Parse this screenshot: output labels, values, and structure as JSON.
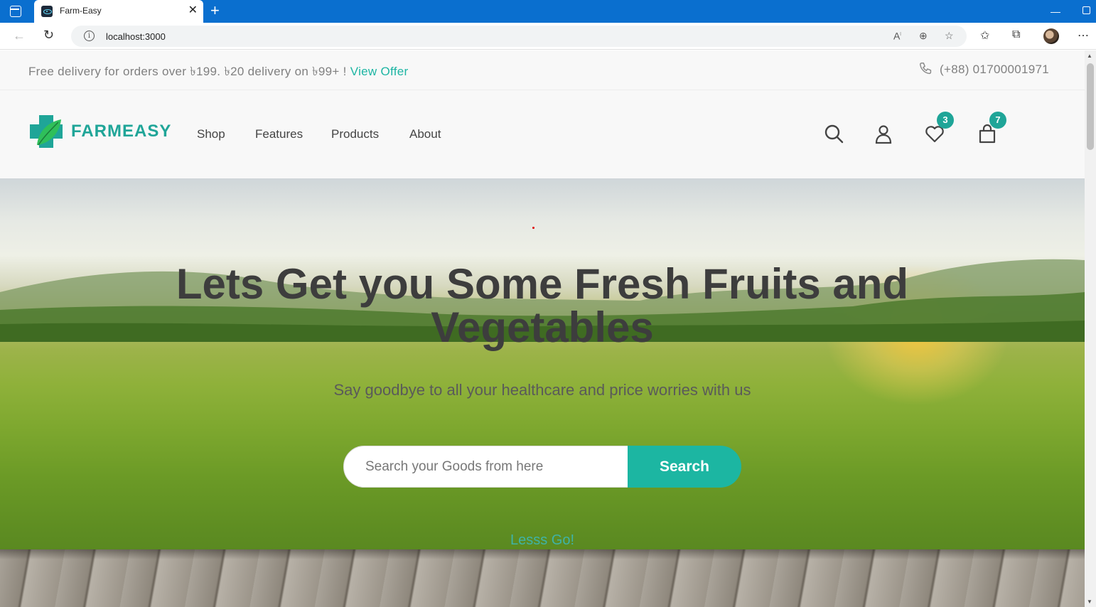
{
  "browser": {
    "tab_title": "Farm-Easy",
    "tab_close": "✕",
    "new_tab": "+",
    "url": "localhost:3000"
  },
  "topbar": {
    "promo_text": "Free delivery for orders over ৳199. ৳20 delivery on ৳99+ ! ",
    "promo_link": "View Offer",
    "phone": "(+88) 01700001971"
  },
  "header": {
    "logo_text": "FARMEASY",
    "nav": [
      "Shop",
      "Features",
      "Products",
      "About"
    ],
    "wishlist_count": "3",
    "cart_count": "7"
  },
  "hero": {
    "title": "Lets Get you Some Fresh Fruits and Vegetables",
    "subtitle": "Say goodbye to all your healthcare and price worries with us",
    "search_placeholder": "Search your Goods from here",
    "search_button": "Search",
    "cta": "Lesss Go!"
  },
  "colors": {
    "brand": "#1fa598",
    "button": "#1cb6a2",
    "browser_accent": "#0a6fcf"
  }
}
